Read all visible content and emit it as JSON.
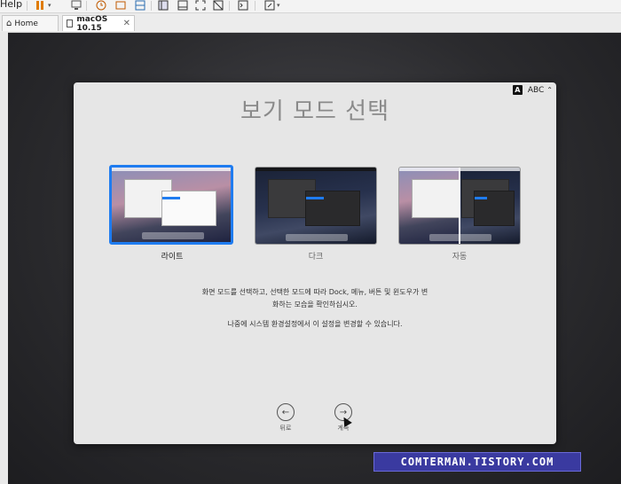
{
  "toolbar": {
    "help_label": "Help"
  },
  "tabs": [
    {
      "label": "Home",
      "icon": "home-icon"
    },
    {
      "label": "macOS 10.15",
      "icon": "vm-icon",
      "close": "✕"
    }
  ],
  "dialog": {
    "title": "보기 모드 선택",
    "language": "ABC",
    "language_badge": "A",
    "options": [
      {
        "label": "라이트",
        "selected": true
      },
      {
        "label": "다크",
        "selected": false
      },
      {
        "label": "자동",
        "selected": false
      }
    ],
    "description_line1": "화면 모드를 선택하고, 선택한 모드에 따라 Dock, 메뉴, 버튼 및 윈도우가 변",
    "description_line2": "화하는 모습을 확인하십시오.",
    "description_line3": "나중에 시스템 환경설정에서 이 설정을 변경할 수 있습니다.",
    "back_label": "뒤로",
    "continue_label": "계속"
  },
  "watermark": "COMTERMAN.TISTORY.COM",
  "colors": {
    "accent": "#1f7cf0",
    "watermark_bg": "#3a3aa0"
  }
}
